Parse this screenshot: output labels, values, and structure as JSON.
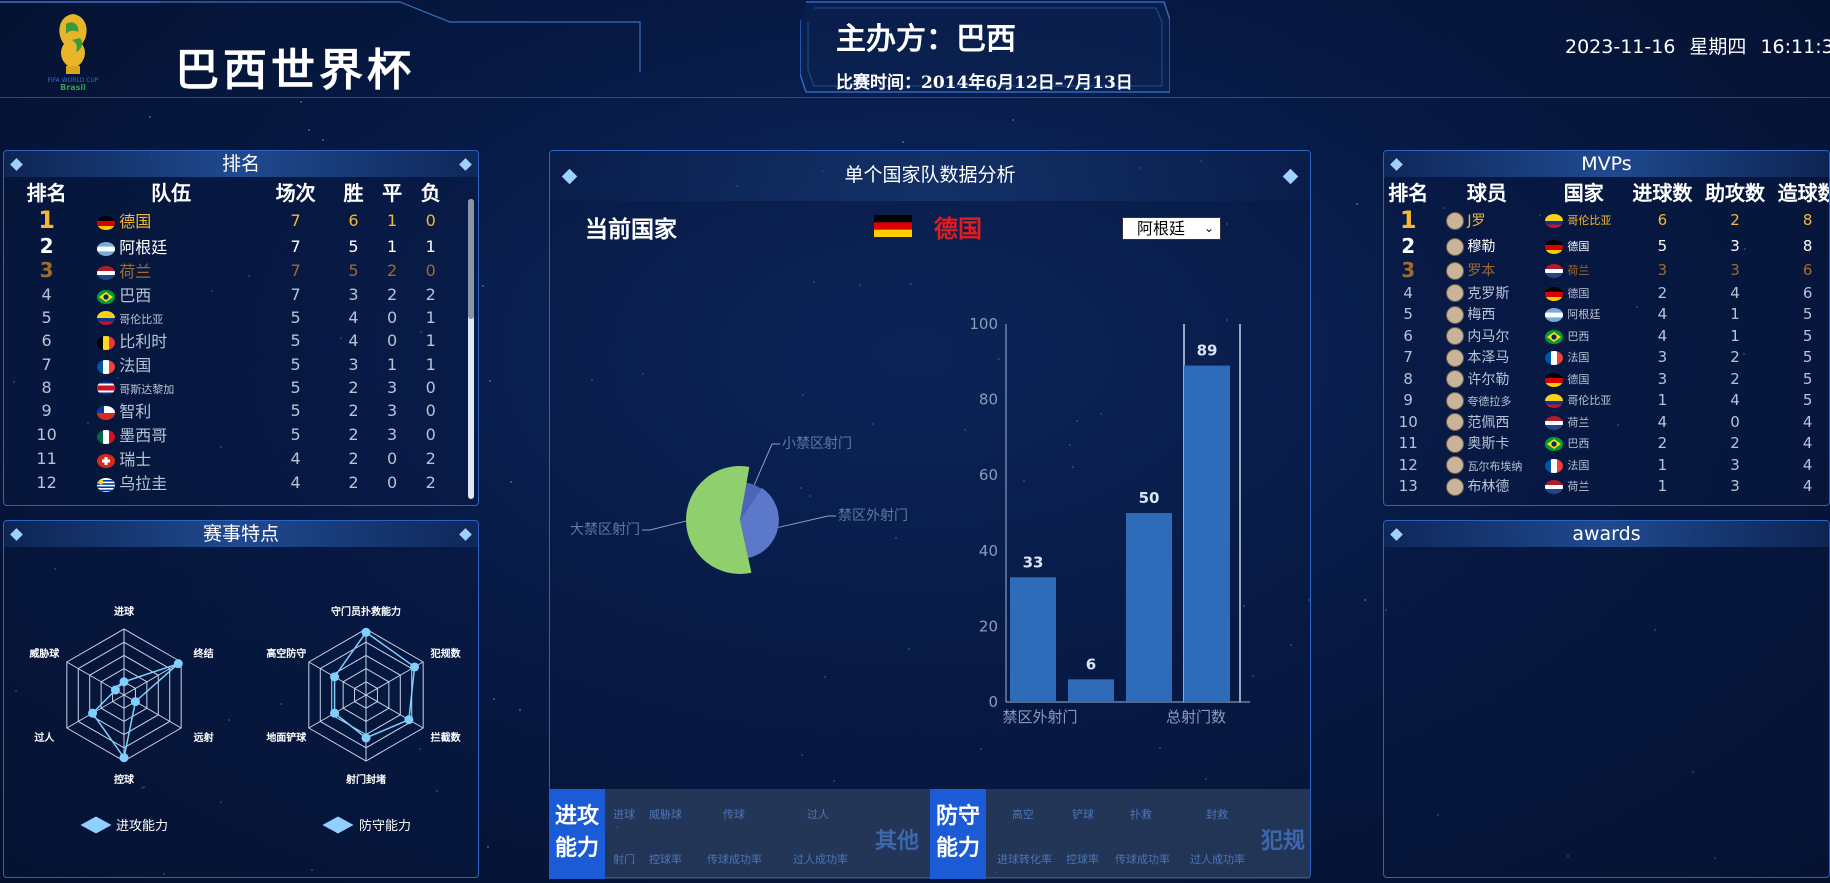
{
  "header": {
    "title": "巴西世界杯",
    "host": "主办方：巴西",
    "match_time": "比赛时间：2014年6月12日–7月13日",
    "date": "2023-11-16",
    "weekday": "星期四",
    "time": "16:11:3"
  },
  "ranking": {
    "title": "排名",
    "headers": [
      "排名",
      "队伍",
      "场次",
      "胜",
      "平",
      "负"
    ],
    "rows": [
      {
        "rank": "1",
        "team": "德国",
        "played": "7",
        "win": "6",
        "draw": "1",
        "loss": "0",
        "flag": "de"
      },
      {
        "rank": "2",
        "team": "阿根廷",
        "played": "7",
        "win": "5",
        "draw": "1",
        "loss": "1",
        "flag": "ar"
      },
      {
        "rank": "3",
        "team": "荷兰",
        "played": "7",
        "win": "5",
        "draw": "2",
        "loss": "0",
        "flag": "nl"
      },
      {
        "rank": "4",
        "team": "巴西",
        "played": "7",
        "win": "3",
        "draw": "2",
        "loss": "2",
        "flag": "br"
      },
      {
        "rank": "5",
        "team": "哥伦比亚",
        "played": "5",
        "win": "4",
        "draw": "0",
        "loss": "1",
        "flag": "co"
      },
      {
        "rank": "6",
        "team": "比利时",
        "played": "5",
        "win": "4",
        "draw": "0",
        "loss": "1",
        "flag": "be"
      },
      {
        "rank": "7",
        "team": "法国",
        "played": "5",
        "win": "3",
        "draw": "1",
        "loss": "1",
        "flag": "fr"
      },
      {
        "rank": "8",
        "team": "哥斯达黎加",
        "played": "5",
        "win": "2",
        "draw": "3",
        "loss": "0",
        "flag": "cr"
      },
      {
        "rank": "9",
        "team": "智利",
        "played": "5",
        "win": "2",
        "draw": "3",
        "loss": "0",
        "flag": "cl"
      },
      {
        "rank": "10",
        "team": "墨西哥",
        "played": "5",
        "win": "2",
        "draw": "3",
        "loss": "0",
        "flag": "mx"
      },
      {
        "rank": "11",
        "team": "瑞士",
        "played": "4",
        "win": "2",
        "draw": "0",
        "loss": "2",
        "flag": "ch"
      },
      {
        "rank": "12",
        "team": "乌拉圭",
        "played": "4",
        "win": "2",
        "draw": "0",
        "loss": "2",
        "flag": "uy"
      }
    ]
  },
  "features": {
    "title": "赛事特点",
    "attack_axes": [
      "进球",
      "终结",
      "远射",
      "控球",
      "过人",
      "威胁球"
    ],
    "defense_axes": [
      "守门员扑救能力",
      "犯规数",
      "拦截数",
      "射门封堵",
      "地面铲球",
      "高空防守"
    ],
    "attack_values": [
      0.2,
      0.95,
      0.2,
      0.95,
      0.55,
      0.15
    ],
    "defense_values": [
      0.95,
      0.85,
      0.75,
      0.65,
      0.55,
      0.55
    ],
    "legend_attack": "进攻能力",
    "legend_defense": "防守能力"
  },
  "analysis": {
    "title": "单个国家队数据分析",
    "current_label": "当前国家",
    "current_country": "德国",
    "select_value": "阿根廷",
    "pie_labels": [
      "小禁区射门",
      "禁区外射门",
      "大禁区射门"
    ],
    "bottom": {
      "attack_label": "进攻\n能力",
      "attack_items_top": [
        "进球",
        "威胁球",
        "传球",
        "过人"
      ],
      "attack_items_bottom": [
        "射门",
        "控球率",
        "传球成功率",
        "过人成功率"
      ],
      "attack_other": "其他",
      "defense_label": "防守\n能力",
      "defense_items_top": [
        "高空",
        "铲球",
        "扑救",
        "封救"
      ],
      "defense_items_bottom": [
        "进球转化率",
        "控球率",
        "传球成功率",
        "过人成功率"
      ],
      "defense_other": "犯规"
    }
  },
  "chart_data": [
    {
      "type": "bar",
      "categories": [
        "禁区外射门",
        "",
        "",
        "总射门数"
      ],
      "values": [
        33,
        6,
        50,
        89
      ],
      "ylim": [
        0,
        100
      ],
      "yticks": [
        "0",
        "20",
        "40",
        "60",
        "80",
        "100"
      ],
      "value_labels": [
        "33",
        "6",
        "50",
        "89"
      ]
    },
    {
      "type": "pie",
      "labels": [
        "小禁区射门",
        "禁区外射门",
        "大禁区射门"
      ],
      "values": [
        6,
        33,
        50
      ]
    }
  ],
  "mvps": {
    "title": "MVPs",
    "headers": [
      "排名",
      "球员",
      "国家",
      "进球数",
      "助攻数",
      "造球数"
    ],
    "rows": [
      {
        "rank": "1",
        "player": "J罗",
        "country": "哥伦比亚",
        "goals": "6",
        "assists": "2",
        "created": "8",
        "flag": "co"
      },
      {
        "rank": "2",
        "player": "穆勒",
        "country": "德国",
        "goals": "5",
        "assists": "3",
        "created": "8",
        "flag": "de"
      },
      {
        "rank": "3",
        "player": "罗本",
        "country": "荷兰",
        "goals": "3",
        "assists": "3",
        "created": "6",
        "flag": "nl"
      },
      {
        "rank": "4",
        "player": "克罗斯",
        "country": "德国",
        "goals": "2",
        "assists": "4",
        "created": "6",
        "flag": "de"
      },
      {
        "rank": "5",
        "player": "梅西",
        "country": "阿根廷",
        "goals": "4",
        "assists": "1",
        "created": "5",
        "flag": "ar"
      },
      {
        "rank": "6",
        "player": "内马尔",
        "country": "巴西",
        "goals": "4",
        "assists": "1",
        "created": "5",
        "flag": "br"
      },
      {
        "rank": "7",
        "player": "本泽马",
        "country": "法国",
        "goals": "3",
        "assists": "2",
        "created": "5",
        "flag": "fr"
      },
      {
        "rank": "8",
        "player": "许尔勒",
        "country": "德国",
        "goals": "3",
        "assists": "2",
        "created": "5",
        "flag": "de"
      },
      {
        "rank": "9",
        "player": "夸德拉多",
        "country": "哥伦比亚",
        "goals": "1",
        "assists": "4",
        "created": "5",
        "flag": "co"
      },
      {
        "rank": "10",
        "player": "范佩西",
        "country": "荷兰",
        "goals": "4",
        "assists": "0",
        "created": "4",
        "flag": "nl"
      },
      {
        "rank": "11",
        "player": "奥斯卡",
        "country": "巴西",
        "goals": "2",
        "assists": "2",
        "created": "4",
        "flag": "br"
      },
      {
        "rank": "12",
        "player": "瓦尔布埃纳",
        "country": "法国",
        "goals": "1",
        "assists": "3",
        "created": "4",
        "flag": "fr"
      },
      {
        "rank": "13",
        "player": "布林德",
        "country": "荷兰",
        "goals": "1",
        "assists": "3",
        "created": "4",
        "flag": "nl"
      }
    ]
  },
  "awards": {
    "title": "awards"
  },
  "colors": {
    "gold": "#f7b733",
    "bronze": "#a06a2e",
    "bar": "#2e6bb8",
    "pie_big": "#8fcf6e",
    "pie_small": "#5b78c9"
  }
}
